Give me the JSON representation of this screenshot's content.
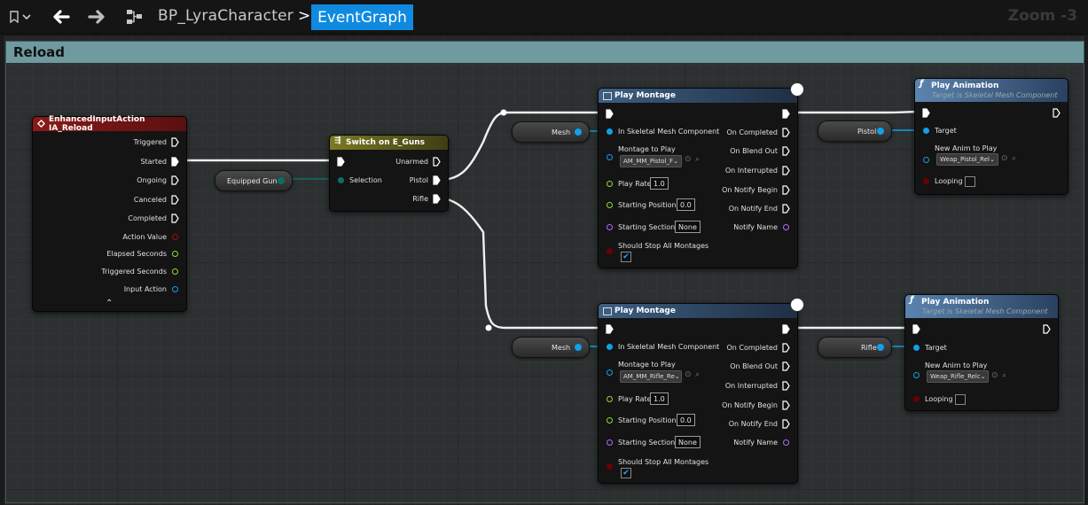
{
  "toolbar": {
    "bookmark_icon": "bookmark-icon",
    "back_icon": "arrow-left-icon",
    "forward_icon": "arrow-right-icon",
    "graph_icon": "blueprint-graph-icon",
    "breadcrumb_parent": "BP_LyraCharacter",
    "breadcrumb_separator": ">",
    "breadcrumb_current": "EventGraph",
    "zoom": "Zoom -3"
  },
  "comment": {
    "title": "Reload"
  },
  "nodes": {
    "input_action": {
      "title": "EnhancedInputAction IA_Reload",
      "pins": [
        "Triggered",
        "Started",
        "Ongoing",
        "Canceled",
        "Completed",
        "Action Value",
        "Elapsed Seconds",
        "Triggered Seconds",
        "Input Action"
      ],
      "expand": "⌃"
    },
    "switch": {
      "title": "Switch on E_Guns",
      "in_selection": "Selection",
      "out_unarmed": "Unarmed",
      "out_pistol": "Pistol",
      "out_rifle": "Rifle"
    },
    "equipped_gun_var": "Equipped Gun",
    "play_montage_1": {
      "title": "Play Montage",
      "in_mesh": "In Skeletal Mesh Component",
      "montage_label": "Montage to Play",
      "montage_value": "AM_MM_Pistol_F",
      "play_rate_label": "Play Rate",
      "play_rate": "1.0",
      "start_pos_label": "Starting Position",
      "start_pos": "0.0",
      "start_section_label": "Starting Section",
      "start_section": "None",
      "stop_all_label": "Should Stop All Montages",
      "stop_all": "✔",
      "outputs": [
        "On Completed",
        "On Blend Out",
        "On Interrupted",
        "On Notify Begin",
        "On Notify End",
        "Notify Name"
      ]
    },
    "play_montage_2": {
      "title": "Play Montage",
      "in_mesh": "In Skeletal Mesh Component",
      "montage_label": "Montage to Play",
      "montage_value": "AM_MM_Rifle_Re",
      "play_rate_label": "Play Rate",
      "play_rate": "1.0",
      "start_pos_label": "Starting Position",
      "start_pos": "0.0",
      "start_section_label": "Starting Section",
      "start_section": "None",
      "stop_all_label": "Should Stop All Montages",
      "stop_all": "✔",
      "outputs": [
        "On Completed",
        "On Blend Out",
        "On Interrupted",
        "On Notify Begin",
        "On Notify End",
        "Notify Name"
      ]
    },
    "mesh_var_1": "Mesh",
    "mesh_var_2": "Mesh",
    "pistol_var": "Pistol",
    "rifle_var": "Rifle",
    "play_anim_1": {
      "title": "Play Animation",
      "subtitle": "Target is Skeletal Mesh Component",
      "target_label": "Target",
      "anim_label": "New Anim to Play",
      "anim_value": "Weap_Pistol_Rel",
      "looping_label": "Looping"
    },
    "play_anim_2": {
      "title": "Play Animation",
      "subtitle": "Target is Skeletal Mesh Component",
      "target_label": "Target",
      "anim_label": "New Anim to Play",
      "anim_value": "Weap_Rifle_Relc",
      "looping_label": "Looping"
    }
  },
  "colors": {
    "exec": "#ffffff",
    "object_pin": "#0fa0e8",
    "enum_pin": "#0a6f66",
    "float_pin": "#8cdb2f",
    "name_pin": "#b06bff",
    "bool_pin": "#8b0000",
    "input_event_header": "#8a1a1a",
    "switch_header": "#6f6f1c",
    "function_header": "#4c6e95",
    "comment_header": "#6e9aa0",
    "breadcrumb_active": "#0f8ae0"
  }
}
